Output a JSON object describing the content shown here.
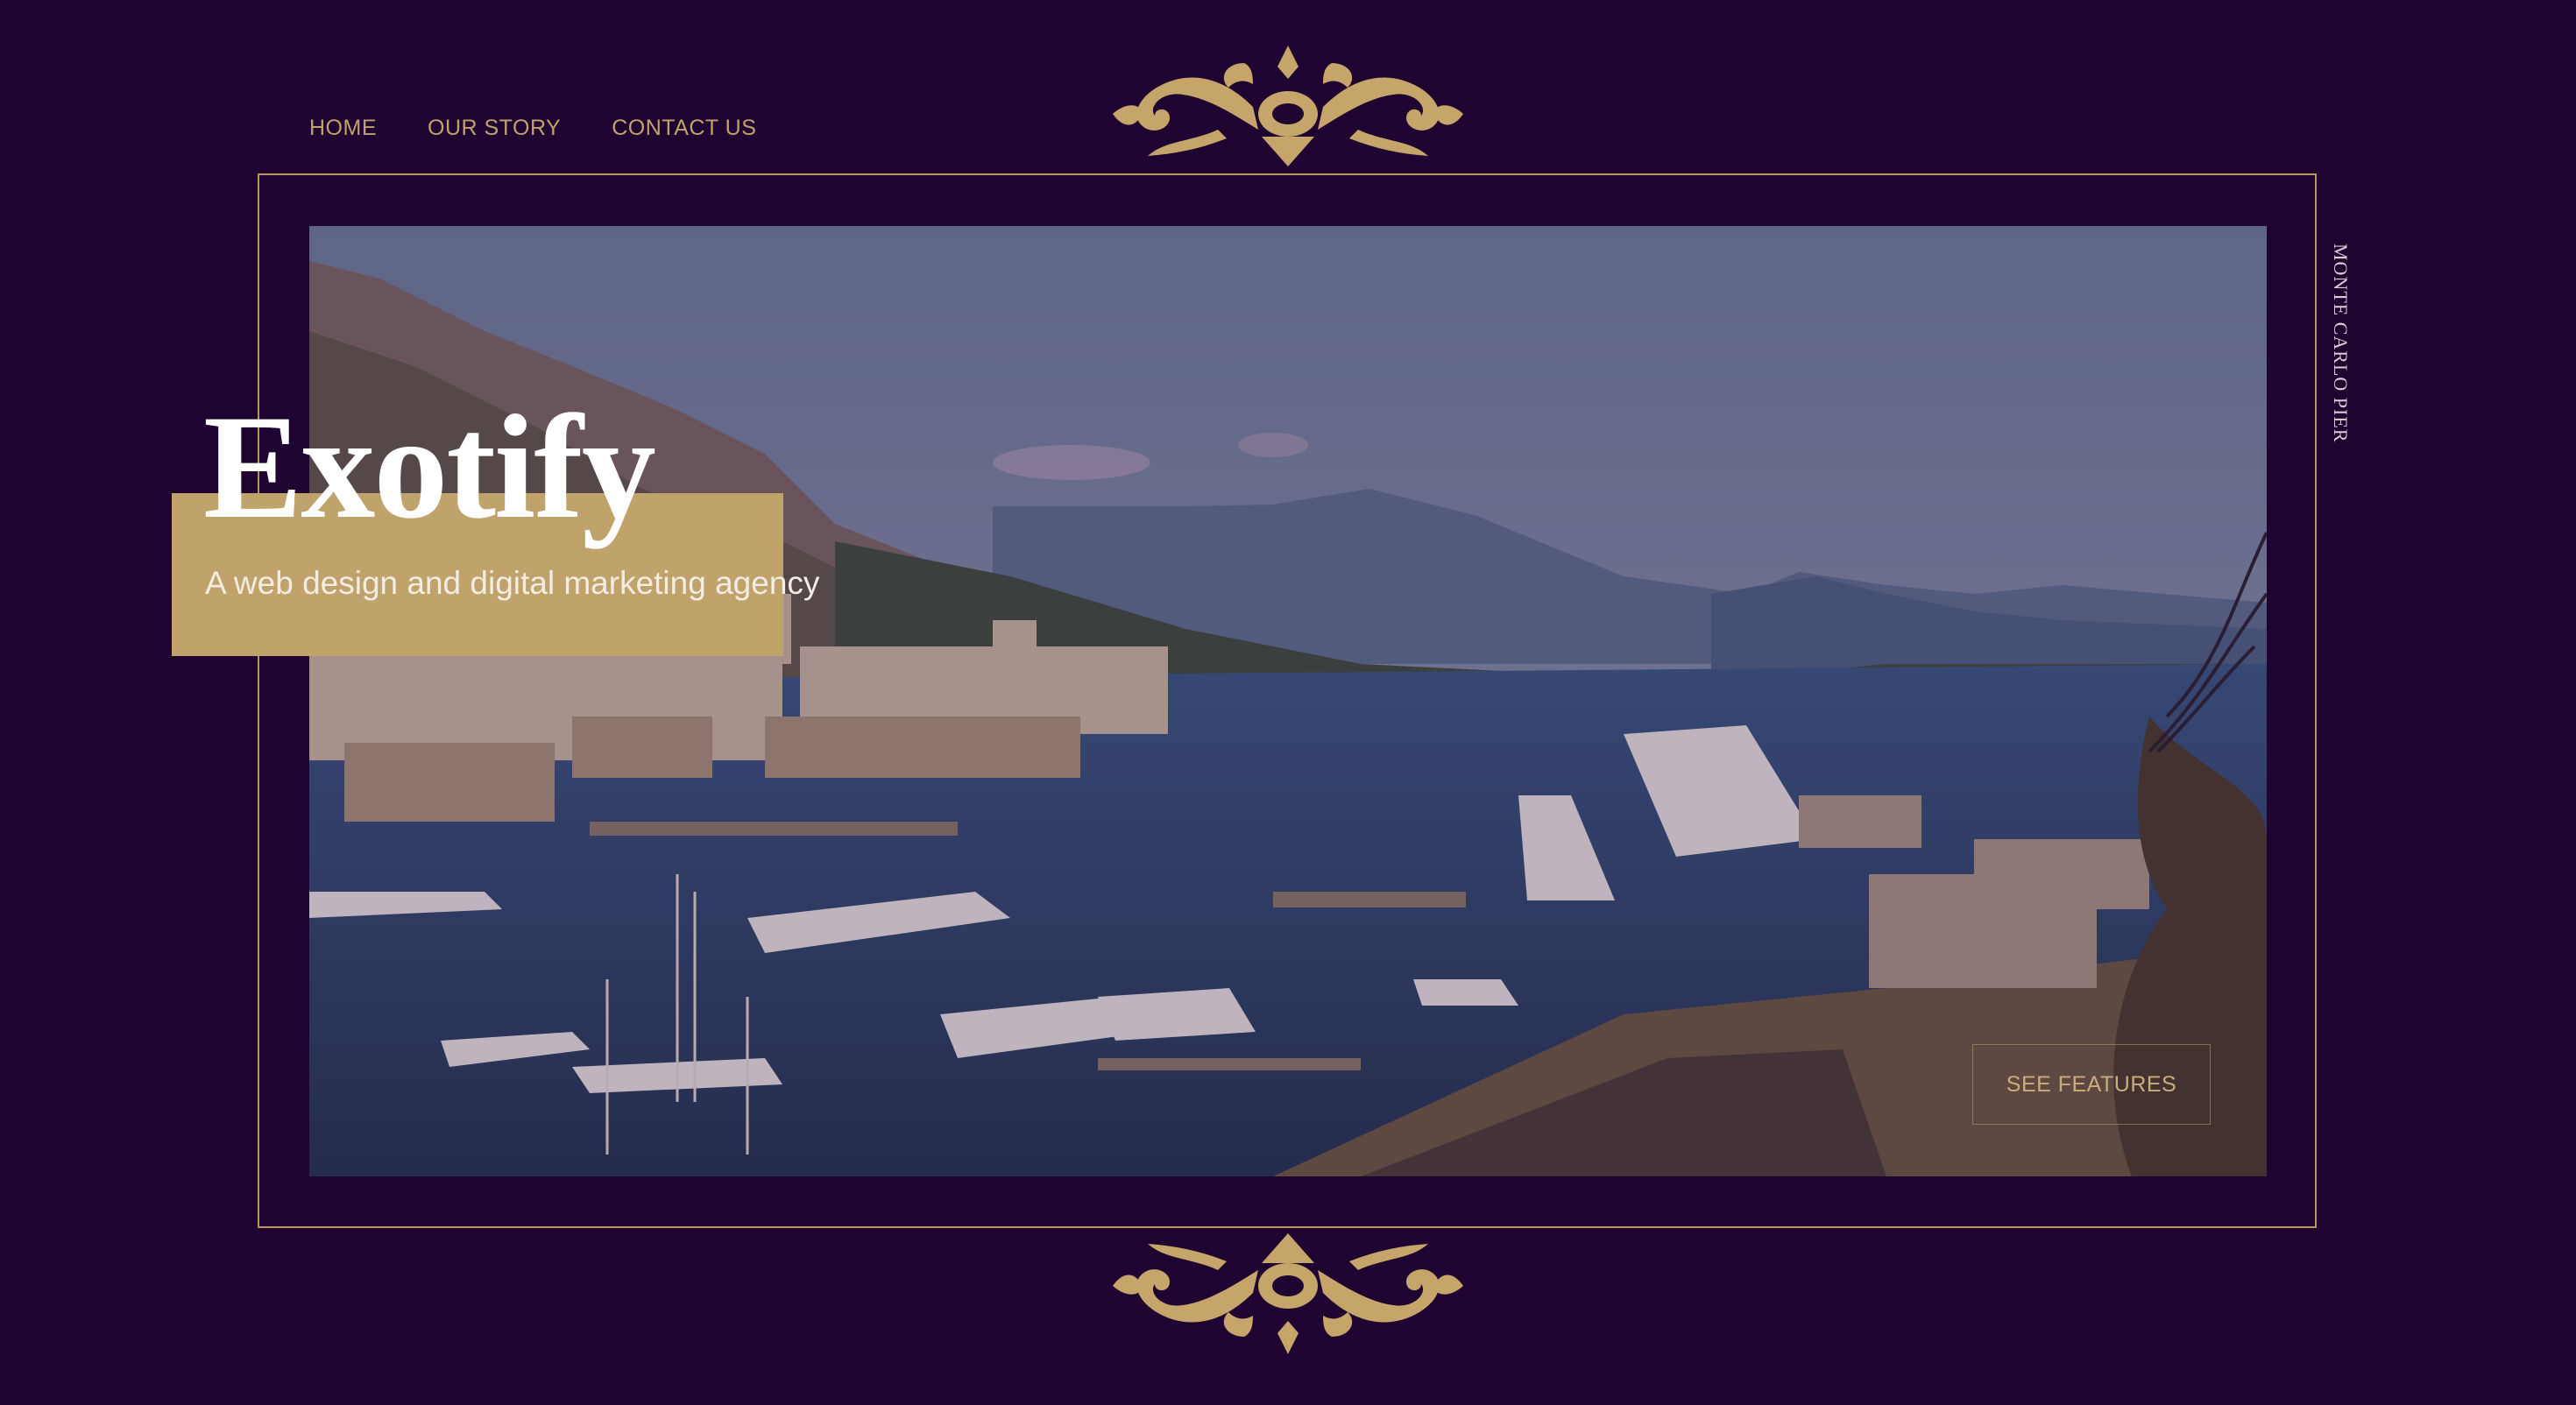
{
  "nav": {
    "items": [
      {
        "label": "HOME"
      },
      {
        "label": "OUR STORY"
      },
      {
        "label": "CONTACT US"
      }
    ]
  },
  "hero": {
    "title": "Exotify",
    "tagline": "A web design and digital marketing agency",
    "side_label": "MONTE CARLO PIER",
    "cta_label": "SEE FEATURES"
  },
  "colors": {
    "background": "#1f0331",
    "gold": "#c0a26b",
    "frame": "#b4955f"
  },
  "icons": {
    "ornament_top": "filigree-ornament-icon",
    "ornament_bottom": "filigree-ornament-icon"
  }
}
